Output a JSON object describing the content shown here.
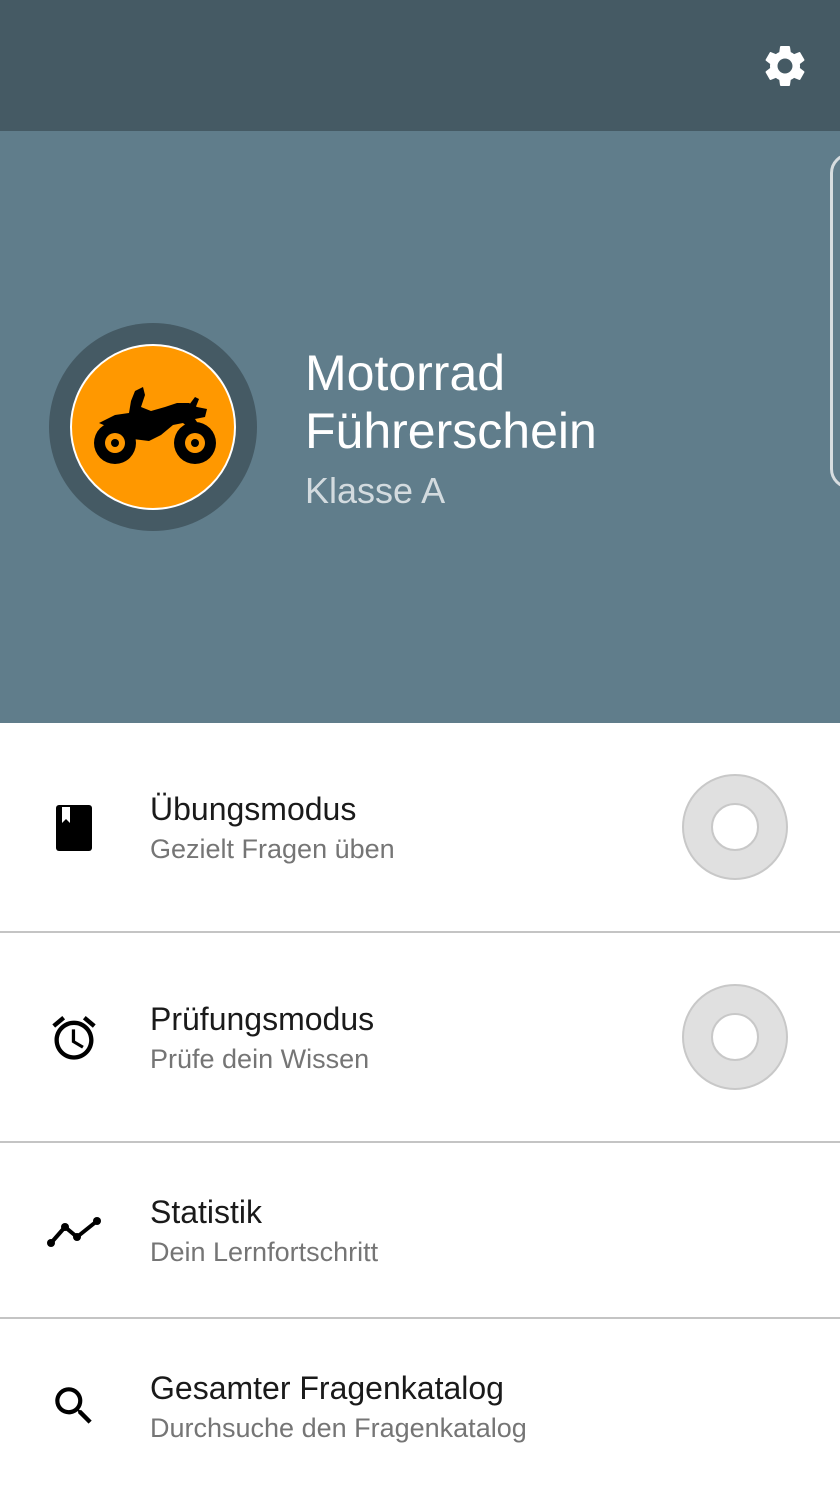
{
  "app": {
    "title_line1": "Motorrad",
    "title_line2": "Führerschein",
    "subtitle": "Klasse A"
  },
  "toolbar": {
    "settings_icon": "gear-icon"
  },
  "menu": {
    "items": [
      {
        "title": "Übungsmodus",
        "subtitle": "Gezielt Fragen üben",
        "icon": "book-icon",
        "progress": 0
      },
      {
        "title": "Prüfungsmodus",
        "subtitle": "Prüfe dein Wissen",
        "icon": "alarm-clock-icon",
        "progress": 0
      },
      {
        "title": "Statistik",
        "subtitle": "Dein Lernfortschritt",
        "icon": "line-chart-icon"
      },
      {
        "title": "Gesamter Fragenkatalog",
        "subtitle": "Durchsuche den Fragenkatalog",
        "icon": "search-icon"
      }
    ]
  },
  "colors": {
    "toolbar": "#455a64",
    "hero": "#607d8b",
    "accent": "#ff9800"
  }
}
